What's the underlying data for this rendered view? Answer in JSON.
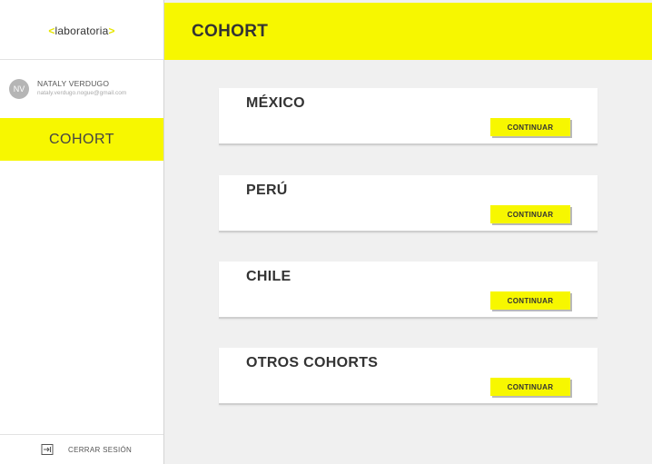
{
  "app": {
    "logo_left": "<",
    "logo_text": "laboratoria",
    "logo_right": ">"
  },
  "user": {
    "initials": "NV",
    "name": "NATALY VERDUGO",
    "email": "nataly.verdugo.nogue@gmail.com"
  },
  "sidebar": {
    "active_item": "COHORT",
    "logout_label": "CERRAR SESIÓN",
    "logout_icon": "logout-icon"
  },
  "header": {
    "title": "COHORT"
  },
  "cohorts": [
    {
      "name": "MÉXICO",
      "button": "CONTINUAR"
    },
    {
      "name": "PERÚ",
      "button": "CONTINUAR"
    },
    {
      "name": "CHILE",
      "button": "CONTINUAR"
    },
    {
      "name": "OTROS COHORTS",
      "button": "CONTINUAR"
    }
  ],
  "colors": {
    "accent": "#f7f700",
    "text": "#333333",
    "background": "#f0f0f0"
  }
}
